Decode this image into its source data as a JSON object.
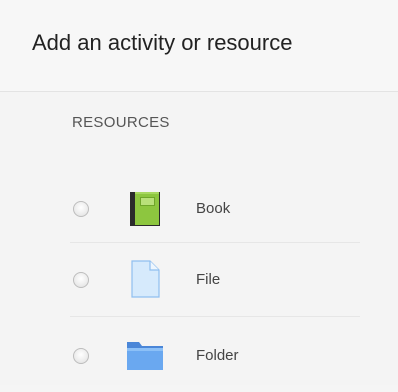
{
  "dialog": {
    "title": "Add an activity or resource"
  },
  "section": {
    "heading": "RESOURCES"
  },
  "options": [
    {
      "label": "Book",
      "icon": "book-icon",
      "selected": false
    },
    {
      "label": "File",
      "icon": "file-icon",
      "selected": false
    },
    {
      "label": "Folder",
      "icon": "folder-icon",
      "selected": false
    }
  ],
  "colors": {
    "book_green": "#8dc63f",
    "book_dark": "#2b2b2b",
    "file_blue": "#cfe6fb",
    "folder_blue": "#5b9bea"
  }
}
